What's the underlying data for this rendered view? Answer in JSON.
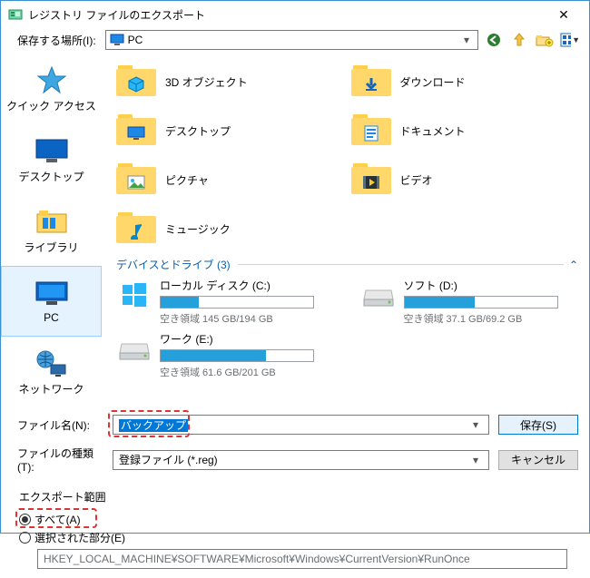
{
  "window": {
    "title": "レジストリ ファイルのエクスポート"
  },
  "toprow": {
    "label": "保存する場所(I):",
    "location": "PC"
  },
  "places": [
    {
      "key": "quick",
      "label": "クイック アクセス"
    },
    {
      "key": "desktop",
      "label": "デスクトップ"
    },
    {
      "key": "library",
      "label": "ライブラリ"
    },
    {
      "key": "pc",
      "label": "PC",
      "selected": true
    },
    {
      "key": "network",
      "label": "ネットワーク"
    }
  ],
  "folders": [
    {
      "key": "3dobjects",
      "label": "3D オブジェクト"
    },
    {
      "key": "downloads",
      "label": "ダウンロード"
    },
    {
      "key": "desktop",
      "label": "デスクトップ"
    },
    {
      "key": "documents",
      "label": "ドキュメント"
    },
    {
      "key": "pictures",
      "label": "ピクチャ"
    },
    {
      "key": "videos",
      "label": "ビデオ"
    },
    {
      "key": "music",
      "label": "ミュージック"
    }
  ],
  "devices_header": "デバイスとドライブ (3)",
  "drives": [
    {
      "name": "ローカル ディスク (C:)",
      "free": "空き領域 145 GB/194 GB",
      "fill_pct": 25,
      "icon": "windows"
    },
    {
      "name": "ソフト (D:)",
      "free": "空き領域 37.1 GB/69.2 GB",
      "fill_pct": 46,
      "icon": "hdd"
    },
    {
      "name": "ワーク (E:)",
      "free": "空き領域 61.6 GB/201 GB",
      "fill_pct": 69,
      "icon": "hdd"
    }
  ],
  "filename": {
    "label": "ファイル名(N):",
    "value": "バックアップ"
  },
  "filetype": {
    "label": "ファイルの種類(T):",
    "value": "登録ファイル (*.reg)"
  },
  "buttons": {
    "save": "保存(S)",
    "cancel": "キャンセル"
  },
  "export": {
    "legend": "エクスポート範囲",
    "all": "すべて(A)",
    "selected": "選択された部分(E)",
    "path": "HKEY_LOCAL_MACHINE¥SOFTWARE¥Microsoft¥Windows¥CurrentVersion¥RunOnce",
    "choice": "all"
  }
}
